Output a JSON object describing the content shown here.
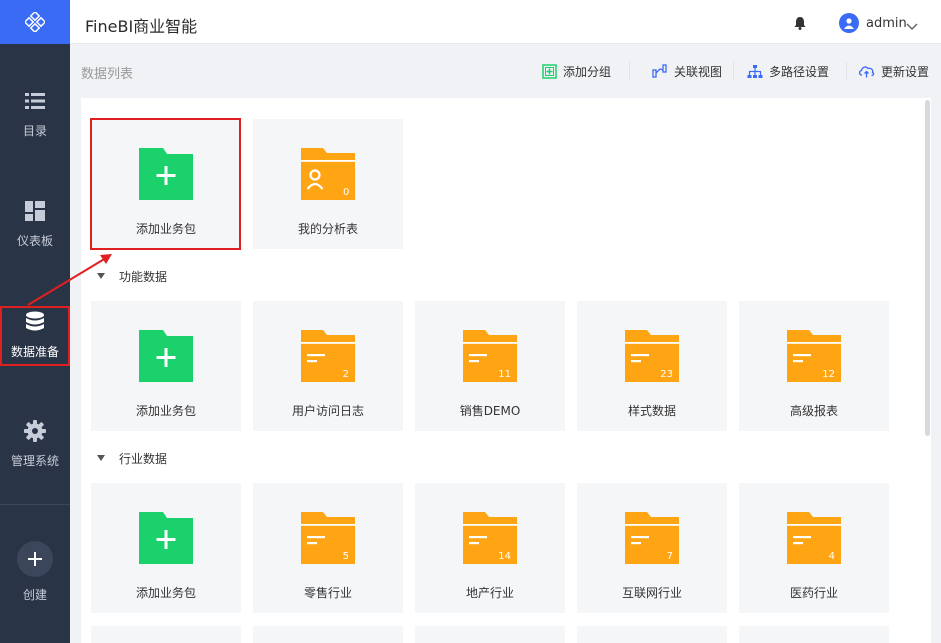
{
  "sidebar": {
    "nav": [
      {
        "id": "catalog",
        "label": "目录",
        "icon": "list-icon"
      },
      {
        "id": "dashboard",
        "label": "仪表板",
        "icon": "dashboard-icon"
      },
      {
        "id": "data-prep",
        "label": "数据准备",
        "icon": "database-icon",
        "active": true
      },
      {
        "id": "admin",
        "label": "管理系统",
        "icon": "gear-icon"
      }
    ],
    "create_label": "创建"
  },
  "header": {
    "title": "FineBI商业智能",
    "user": "admin"
  },
  "toolbar": {
    "list_title": "数据列表",
    "add_group": "添加分组",
    "relation_view": "关联视图",
    "multi_path": "多路径设置",
    "update_settings": "更新设置"
  },
  "top_cards": [
    {
      "label": "添加业务包",
      "kind": "add"
    },
    {
      "label": "我的分析表",
      "kind": "user",
      "count": "0"
    }
  ],
  "sections": [
    {
      "title": "功能数据",
      "cards": [
        {
          "label": "添加业务包",
          "kind": "add"
        },
        {
          "label": "用户访问日志",
          "kind": "folder",
          "count": "2"
        },
        {
          "label": "销售DEMO",
          "kind": "folder",
          "count": "11"
        },
        {
          "label": "样式数据",
          "kind": "folder",
          "count": "23"
        },
        {
          "label": "高级报表",
          "kind": "folder",
          "count": "12"
        }
      ]
    },
    {
      "title": "行业数据",
      "cards": [
        {
          "label": "添加业务包",
          "kind": "add"
        },
        {
          "label": "零售行业",
          "kind": "folder",
          "count": "5"
        },
        {
          "label": "地产行业",
          "kind": "folder",
          "count": "14"
        },
        {
          "label": "互联网行业",
          "kind": "folder",
          "count": "7"
        },
        {
          "label": "医药行业",
          "kind": "folder",
          "count": "4"
        }
      ]
    }
  ],
  "colors": {
    "sidebar_bg": "#2a3447",
    "accent_blue": "#3a6bf5",
    "add_green": "#1ad16b",
    "folder_orange": "#ffa412",
    "highlight_red": "#e02020"
  }
}
